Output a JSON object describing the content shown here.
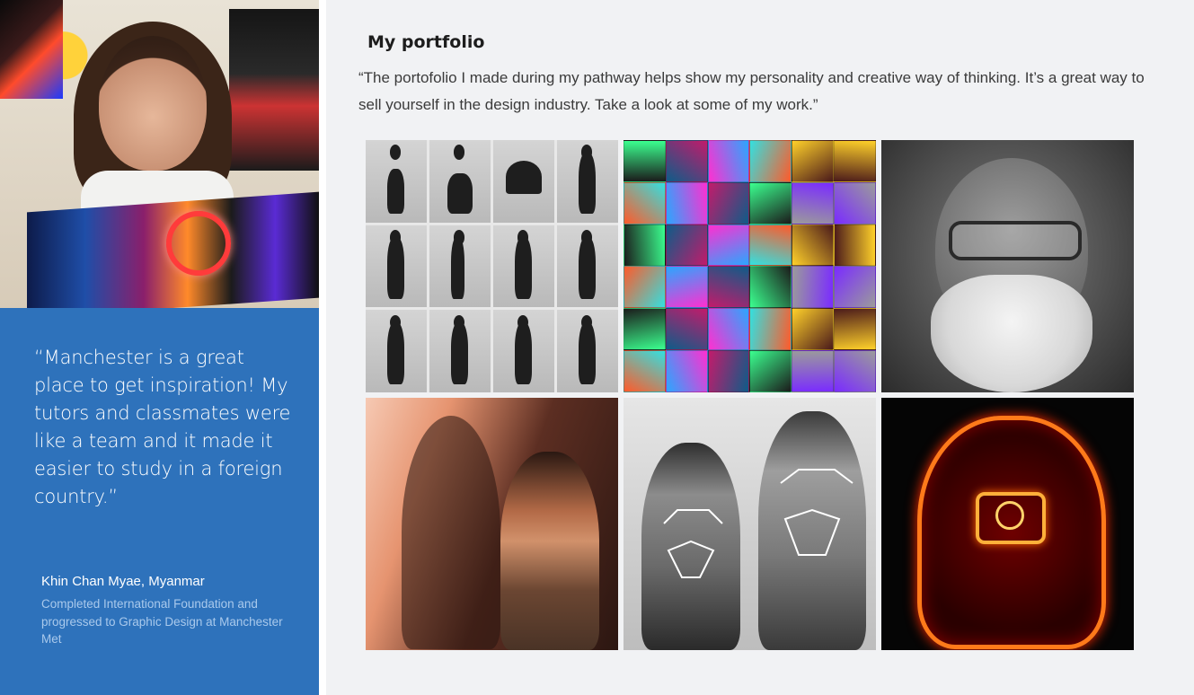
{
  "testimonial": {
    "quote": "“Manchester is a great place to get inspiration! My tutors and classmates were like a team and it made it easier to study in a foreign country.”",
    "name": "Khin Chan Myae, Myanmar",
    "description": "Completed International Foundation and progressed to Graphic Design at Manchester Met"
  },
  "portfolio": {
    "title": "My portfolio",
    "quote": "“The portofolio I made during my pathway helps show my personality and creative way of thinking. It’s a great way to sell yourself in the design industry. Take a look at some of my work.”"
  },
  "colors": {
    "quote_panel": "#2e72bb",
    "right_panel": "#f1f2f4"
  }
}
